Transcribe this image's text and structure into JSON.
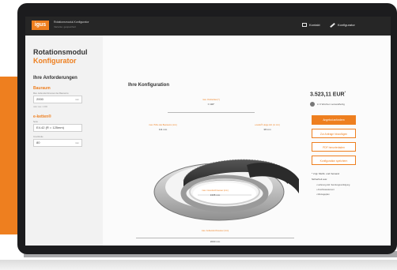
{
  "brand": {
    "logo_text": "igus",
    "accent": "#ee7f1f"
  },
  "header": {
    "app_title": "Rotationsmodul-Konfigurator",
    "app_subtitle": "Variante: gespeichert",
    "nav": [
      {
        "label": "Kontakt",
        "icon": "mail-icon"
      },
      {
        "label": "Konfigurator",
        "icon": "wrench-icon"
      }
    ]
  },
  "sidebar": {
    "title_line1": "Rotationsmodul",
    "title_line2": "Konfigurator",
    "requirements_heading": "Ihre Anforderungen",
    "section_space": "Bauraum",
    "space_field_label": "Max. Außendurchmesser des Bauraums",
    "space_value": "2000",
    "space_unit": "mm",
    "space_hint": "oder max. 2.000",
    "section_chain": "e-ketten®",
    "chain_field_label": "Serie",
    "chain_value": "E4.42 (R = 125mm)",
    "count_field_label": "Innenbreite",
    "count_value": "80",
    "count_unit": "mm"
  },
  "main": {
    "heading": "Ihre Konfiguration",
    "dims": {
      "angle_label": "max. Drehwinkel (°)",
      "angle_value": "± 190°",
      "left_label": "max. Höhe des Bauraums (mm)",
      "left_value": "111 mm",
      "right_label": "e-kette® Länge inkl. (in mm)",
      "right_value": "38 mm",
      "inner_label": "max. Innendurchmesser (mm)",
      "inner_value": "1335 mm",
      "outer_label": "max. Außendurchmesser (mm)",
      "outer_value": "2000 mm"
    }
  },
  "summary": {
    "price": "3.523,11 EUR",
    "price_mark": "*",
    "delivery": "in 6 Wochen versandfertig",
    "buttons": [
      "Angebot anfordern",
      "Zur Anfrage hinzufügen",
      "PDF herunterladen",
      "Konfiguration speichern"
    ],
    "note": "* zzgl. MwSt. und Versand",
    "includes_heading": "Sicherheit aus:",
    "includes": [
      "Lieferung inkl. Sendungsverfolgung",
      "Anschlusselement",
      "Montageplan"
    ]
  }
}
